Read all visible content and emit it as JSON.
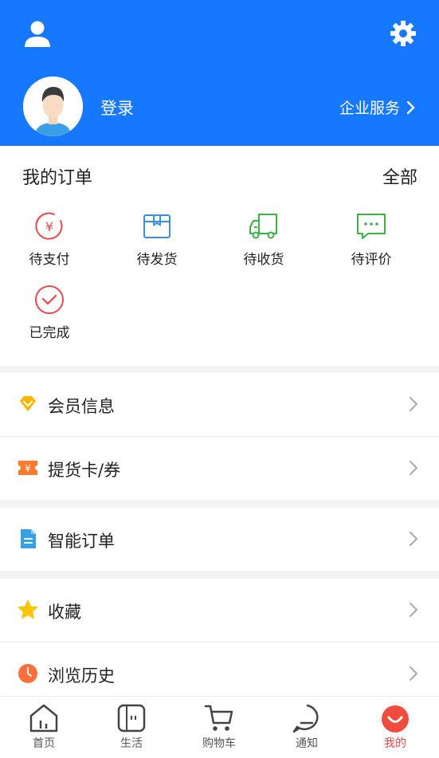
{
  "header": {
    "login_label": "登录",
    "enterprise_label": "企业服务",
    "accent_color": "#1677ff"
  },
  "orders": {
    "title": "我的订单",
    "all_label": "全部",
    "items": [
      {
        "label": "待支付",
        "icon": "payment-pending-icon",
        "color": "#e5484d"
      },
      {
        "label": "待发货",
        "icon": "box-icon",
        "color": "#3a8ee6"
      },
      {
        "label": "待收货",
        "icon": "truck-icon",
        "color": "#3cb043"
      },
      {
        "label": "待评价",
        "icon": "comment-icon",
        "color": "#3cb043"
      },
      {
        "label": "已完成",
        "icon": "check-circle-icon",
        "color": "#e5484d"
      }
    ]
  },
  "menu": [
    {
      "label": "会员信息",
      "icon": "diamond-icon"
    },
    {
      "label": "提货卡/券",
      "icon": "ticket-icon"
    },
    {
      "label": "智能订单",
      "icon": "document-icon"
    },
    {
      "label": "收藏",
      "icon": "star-icon"
    },
    {
      "label": "浏览历史",
      "icon": "clock-icon"
    }
  ],
  "tabbar": [
    {
      "label": "首页",
      "icon": "home-icon",
      "active": false
    },
    {
      "label": "生活",
      "icon": "life-icon",
      "active": false
    },
    {
      "label": "购物车",
      "icon": "cart-icon",
      "active": false
    },
    {
      "label": "通知",
      "icon": "notification-icon",
      "active": false
    },
    {
      "label": "我的",
      "icon": "profile-smile-icon",
      "active": true
    }
  ]
}
